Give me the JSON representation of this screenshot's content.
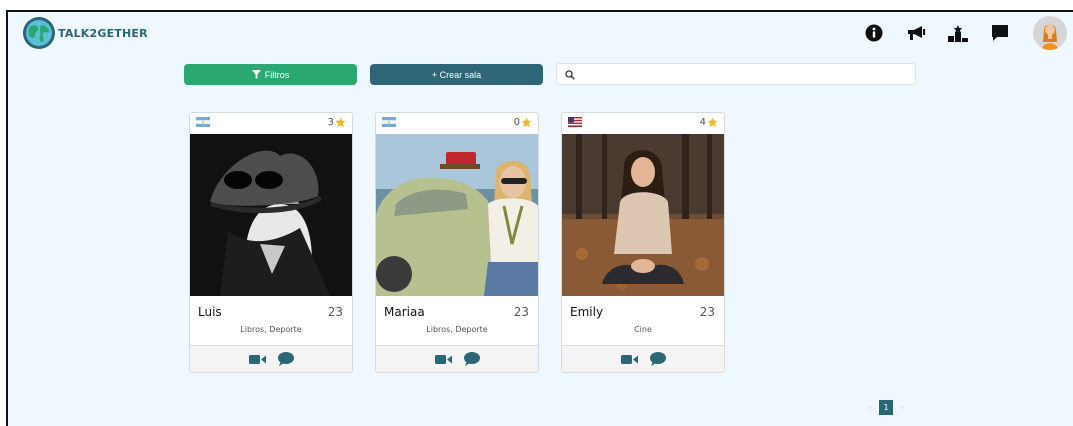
{
  "brand": {
    "name": "TALK2GETHER",
    "logo_icon": "globe-logo-icon"
  },
  "nav": {
    "icons": [
      "info-icon",
      "megaphone-icon",
      "ranking-icon",
      "chat-icon"
    ],
    "avatar_icon": "user-avatar"
  },
  "toolbar": {
    "filter_label": "Filtros",
    "create_label": "+ Crear sala",
    "search_placeholder": ""
  },
  "colors": {
    "accent_green": "#2aa871",
    "accent_teal": "#2e6677",
    "brand_text": "#2b6674",
    "star": "#f5b82e"
  },
  "cards": [
    {
      "name": "Luis",
      "age": "23",
      "rating": "3",
      "tags": "Libros, Deporte",
      "flag": "argentina-flag",
      "photo": "man-with-hat-photo"
    },
    {
      "name": "Mariaa",
      "age": "23",
      "rating": "0",
      "tags": "Libros, Deporte",
      "flag": "argentina-flag",
      "photo": "woman-with-car-photo"
    },
    {
      "name": "Emily",
      "age": "23",
      "rating": "4",
      "tags": "Cine",
      "flag": "usa-flag",
      "photo": "woman-in-leaves-photo"
    }
  ],
  "pagination": {
    "prev": "‹",
    "current": "1",
    "next": "›"
  }
}
